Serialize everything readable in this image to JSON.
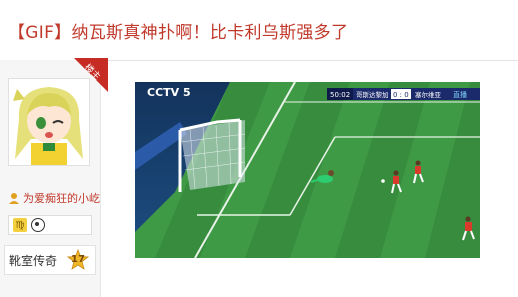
{
  "post": {
    "title": "【GIF】纳瓦斯真神扑啊！比卡利乌斯强多了"
  },
  "user": {
    "ribbon_label": "楼主",
    "username": "为爱痴狂的小屹",
    "zodiac": "♍",
    "rank_title": "靴室传奇",
    "rank_level": "17"
  },
  "video": {
    "channel_logo": "CCTV 5",
    "match_time": "50:02",
    "home_team": "哥斯达黎加",
    "score": "0 : 0",
    "away_team": "塞尔维亚",
    "broadcast_tag": "直播",
    "colors": {
      "pitch_light": "#3f9a45",
      "pitch_dark": "#2f7d36",
      "scoreboard": "#1b2a6b",
      "player_red": "#d93a2b",
      "goalkeeper": "#2ecc71"
    }
  }
}
